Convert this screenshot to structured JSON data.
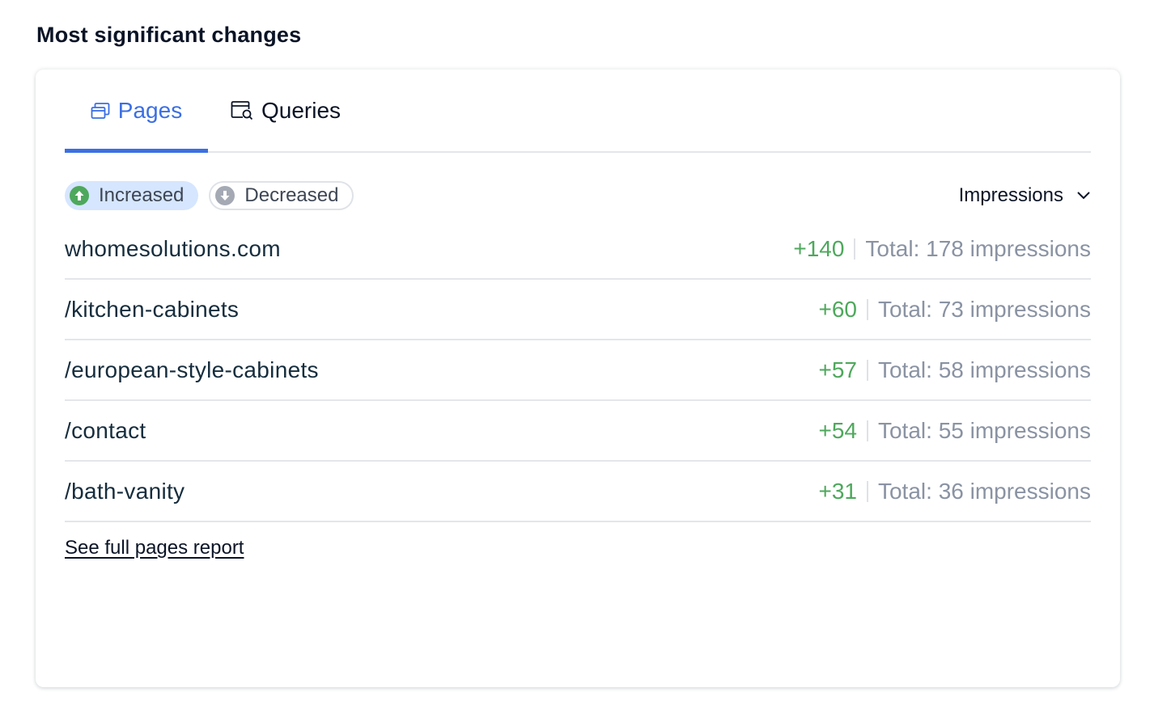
{
  "section": {
    "title": "Most significant changes"
  },
  "tabs": [
    {
      "label": "Pages",
      "icon": "pages-icon",
      "active": true
    },
    {
      "label": "Queries",
      "icon": "queries-search-icon",
      "active": false
    }
  ],
  "filters": {
    "increased_label": "Increased",
    "decreased_label": "Decreased",
    "selected": "Increased"
  },
  "metric": {
    "selected": "Impressions"
  },
  "rows": [
    {
      "path": "whomesolutions.com",
      "change": "+140",
      "total": "Total: 178 impressions"
    },
    {
      "path": "/kitchen-cabinets",
      "change": "+60",
      "total": "Total: 73 impressions"
    },
    {
      "path": "/european-style-cabinets",
      "change": "+57",
      "total": "Total: 58 impressions"
    },
    {
      "path": "/contact",
      "change": "+54",
      "total": "Total: 55 impressions"
    },
    {
      "path": "/bath-vanity",
      "change": "+31",
      "total": "Total: 36 impressions"
    }
  ],
  "footer": {
    "link_label": "See full pages report"
  },
  "colors": {
    "accent": "#3b6fe3",
    "positive": "#4ea85c",
    "muted_text": "#8a93a3",
    "chip_selected_bg": "#d6e6fe"
  }
}
